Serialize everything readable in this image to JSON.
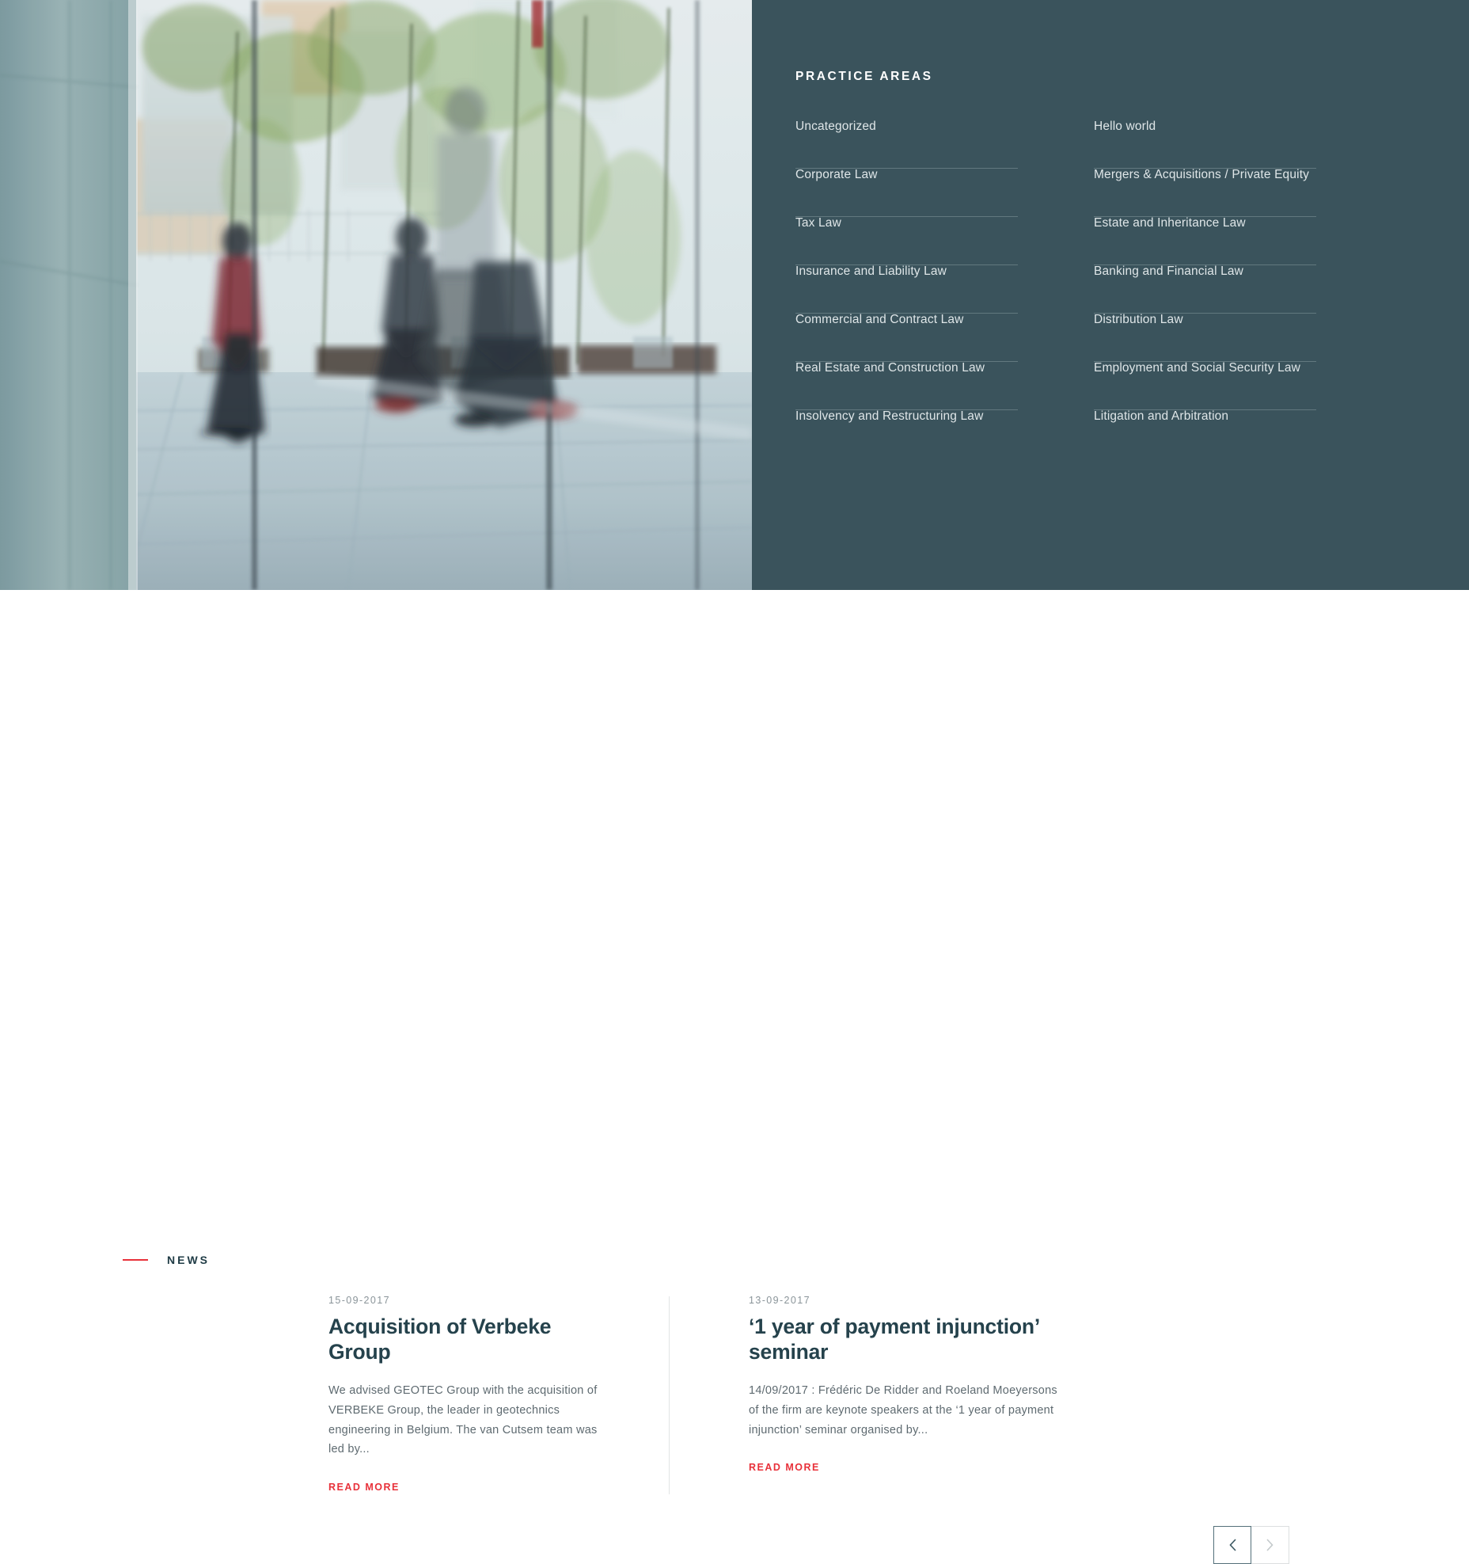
{
  "practice": {
    "title": "PRACTICE AREAS",
    "items": [
      "Uncategorized",
      "Hello world",
      "Corporate Law",
      "Mergers & Acquisitions / Private Equity",
      "Tax Law",
      "Estate and Inheritance Law",
      "Insurance and Liability Law",
      "Banking and Financial Law",
      "Commercial and Contract Law",
      "Distribution Law",
      "Real Estate and Construction Law",
      "Employment and Social Security Law",
      "Insolvency and Restructuring Law",
      "Litigation and Arbitration"
    ]
  },
  "news": {
    "section_label": "NEWS",
    "cards": [
      {
        "date": "15-09-2017",
        "title": "Acquisition of Verbeke Group",
        "excerpt": "  We advised GEOTEC Group  with the acquisition of VERBEKE Group, the leader in geotechnics engineering in Belgium. The van Cutsem team was led by...",
        "read_more": "READ MORE"
      },
      {
        "date": "13-09-2017",
        "title": "‘1 year of payment injunction’ seminar",
        "excerpt": "14/09/2017 : Frédéric De Ridder and Roeland Moeyersons of the firm are keynote speakers at the ‘1 year of payment injunction’ seminar organised by...",
        "read_more": "READ MORE"
      }
    ]
  },
  "carousel": {
    "prev_icon": "chevron-left-icon",
    "next_icon": "chevron-right-icon"
  },
  "hero": {
    "image_alt": "blurred office atrium with walking people"
  },
  "colors": {
    "panel_bg": "#3a535c",
    "accent_red": "#e8313a",
    "heading_dark": "#25424c",
    "rule": "#62787f"
  }
}
